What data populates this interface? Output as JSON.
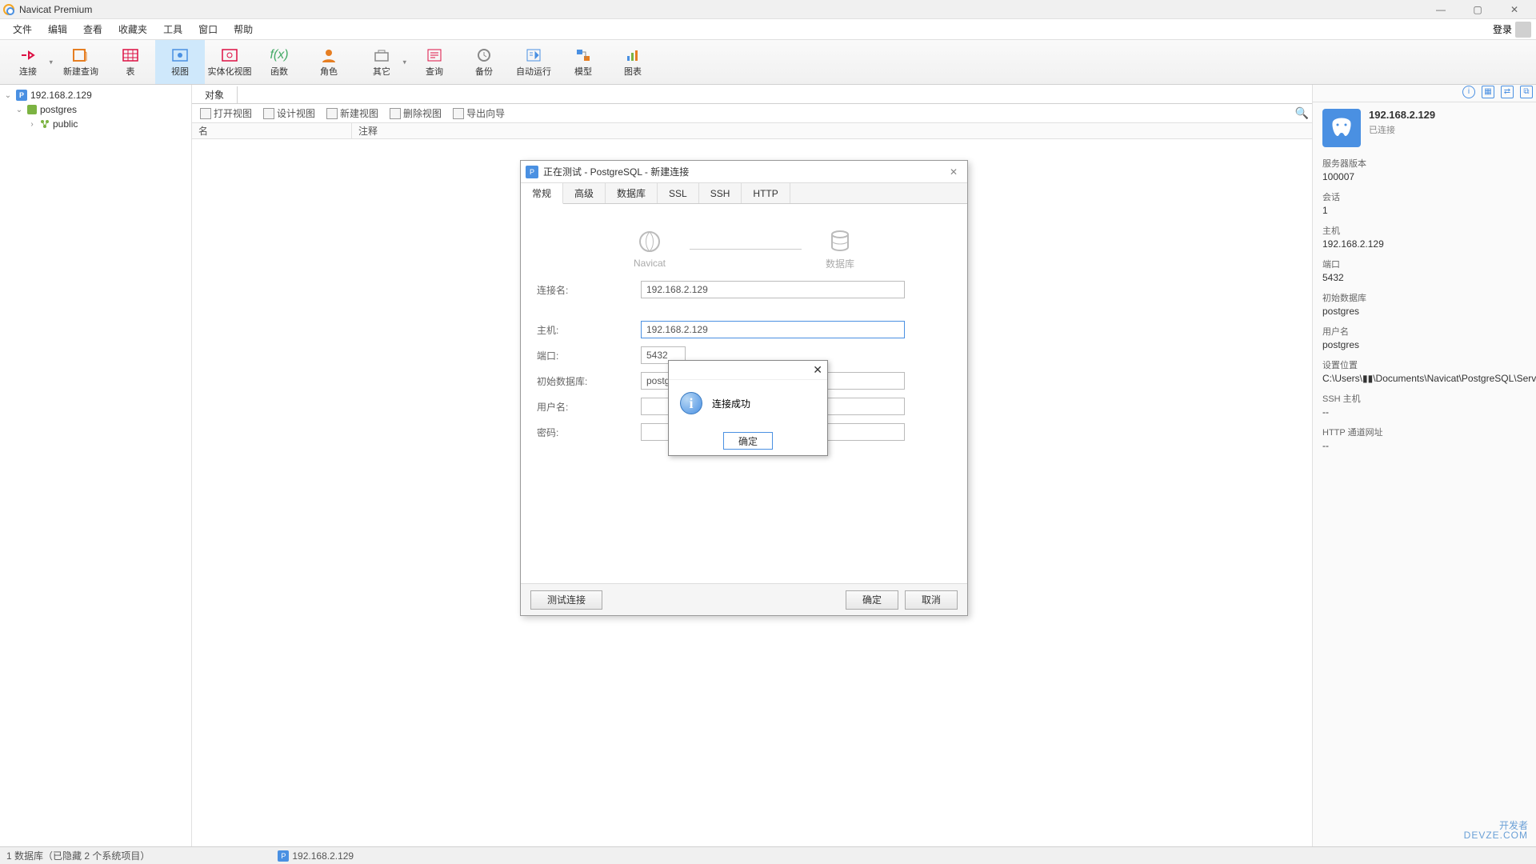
{
  "window": {
    "title": "Navicat Premium"
  },
  "menu": {
    "items": [
      "文件",
      "编辑",
      "查看",
      "收藏夹",
      "工具",
      "窗口",
      "帮助"
    ],
    "login": "登录"
  },
  "toolbar": {
    "items": [
      {
        "label": "连接",
        "icon": "plug",
        "drop": true
      },
      {
        "label": "新建查询",
        "icon": "newq"
      },
      {
        "label": "表",
        "icon": "table"
      },
      {
        "label": "视图",
        "icon": "view",
        "sel": true
      },
      {
        "label": "实体化视图",
        "icon": "mview"
      },
      {
        "label": "函数",
        "icon": "func"
      },
      {
        "label": "角色",
        "icon": "role"
      },
      {
        "label": "其它",
        "icon": "other",
        "drop": true
      },
      {
        "label": "查询",
        "icon": "query"
      },
      {
        "label": "备份",
        "icon": "backup"
      },
      {
        "label": "自动运行",
        "icon": "auto"
      },
      {
        "label": "模型",
        "icon": "model"
      },
      {
        "label": "图表",
        "icon": "chart"
      }
    ]
  },
  "tree": {
    "conn": "192.168.2.129",
    "db": "postgres",
    "schema": "public"
  },
  "tabs": {
    "main": "对象"
  },
  "subtoolbar": {
    "items": [
      "打开视图",
      "设计视图",
      "新建视图",
      "删除视图",
      "导出向导"
    ]
  },
  "columns": {
    "c1": "名",
    "c2": "注释"
  },
  "right": {
    "title": "192.168.2.129",
    "status": "已连接",
    "props": [
      {
        "k": "服务器版本",
        "v": "100007"
      },
      {
        "k": "会话",
        "v": "1"
      },
      {
        "k": "主机",
        "v": "192.168.2.129"
      },
      {
        "k": "端口",
        "v": "5432"
      },
      {
        "k": "初始数据库",
        "v": "postgres"
      },
      {
        "k": "用户名",
        "v": "postgres"
      },
      {
        "k": "设置位置",
        "v": "C:\\Users\\▮▮\\Documents\\Navicat\\PostgreSQL\\Serv"
      },
      {
        "k": "SSH 主机",
        "v": "--"
      },
      {
        "k": "HTTP 通道网址",
        "v": "--"
      }
    ]
  },
  "statusbar": {
    "s1": "1 数据库（已隐藏 2 个系统项目）",
    "s2": "192.168.2.129"
  },
  "dialog": {
    "title": "正在测试 - PostgreSQL - 新建连接",
    "tabs": [
      "常规",
      "高级",
      "数据库",
      "SSL",
      "SSH",
      "HTTP"
    ],
    "vis": {
      "left": "Navicat",
      "right": "数据库"
    },
    "fields": {
      "conn_name_lbl": "连接名:",
      "conn_name": "192.168.2.129",
      "host_lbl": "主机:",
      "host": "192.168.2.129",
      "port_lbl": "端口:",
      "port": "5432",
      "initdb_lbl": "初始数据库:",
      "initdb": "postgres",
      "user_lbl": "用户名:",
      "user": "",
      "pass_lbl": "密码:",
      "pass": ""
    },
    "footer": {
      "test": "测试连接",
      "ok": "确定",
      "cancel": "取消"
    }
  },
  "msgbox": {
    "text": "连接成功",
    "ok": "确定"
  },
  "watermark": {
    "main": "开发者",
    "sub": "DEVZE.COM"
  }
}
